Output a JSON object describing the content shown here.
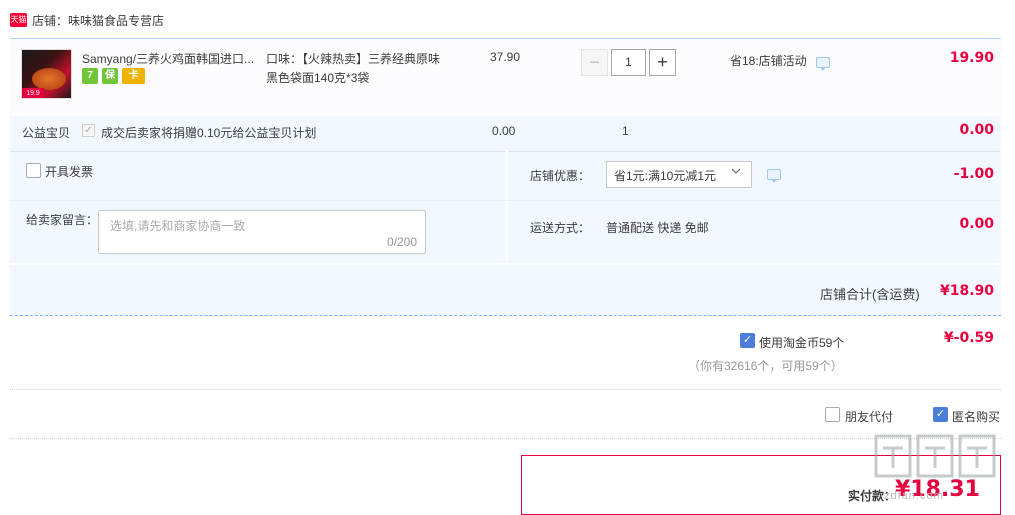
{
  "shop": {
    "badge": "天猫",
    "label": "店铺：",
    "name": "味味猫食品专营店"
  },
  "item": {
    "thumb_price": "19.9",
    "title": "Samyang/三养火鸡面韩国进口...",
    "services": [
      "7",
      "保",
      "卡"
    ],
    "sku_line1": "口味：【火辣热卖】三养经典原味",
    "sku_line2": "黑色袋面140克*3袋",
    "price": "37.90",
    "qty_minus": "−",
    "qty": "1",
    "qty_plus": "+",
    "promo": "省18:店铺活动",
    "total": "19.90"
  },
  "charity": {
    "label": "公益宝贝",
    "check": "✓",
    "desc": "成交后卖家将捐赠0.10元给公益宝贝计划",
    "price": "0.00",
    "qty": "1",
    "total": "0.00"
  },
  "options": {
    "invoice_label": "开具发票",
    "message_label": "给卖家留言：",
    "message_placeholder": "选填,请先和商家协商一致",
    "message_count": "0/200",
    "discount_label": "店铺优惠：",
    "discount_selected": "省1元:满10元减1元",
    "discount_amount": "-1.00",
    "shipping_label": "运送方式：",
    "shipping_value": "普通配送 快递 免邮",
    "shipping_amount": "0.00"
  },
  "shop_total": {
    "label": "店铺合计(含运费)",
    "amount": "¥18.90"
  },
  "coins": {
    "check": "✓",
    "label": "使用淘金币59个",
    "amount": "¥-0.59",
    "note": "（你有32616个，可用59个）"
  },
  "extras": {
    "friend_label": "朋友代付",
    "anon_check": "✓",
    "anon_label": "匿名购买"
  },
  "payment": {
    "label": "实付款：",
    "amount": "¥18.31"
  },
  "watermark": {
    "text": "zdfan.com"
  },
  "colors": {
    "accent_red": "#e5003e",
    "row_bg": "#f3f7ff",
    "checkbox_blue": "#4b7ed8"
  }
}
